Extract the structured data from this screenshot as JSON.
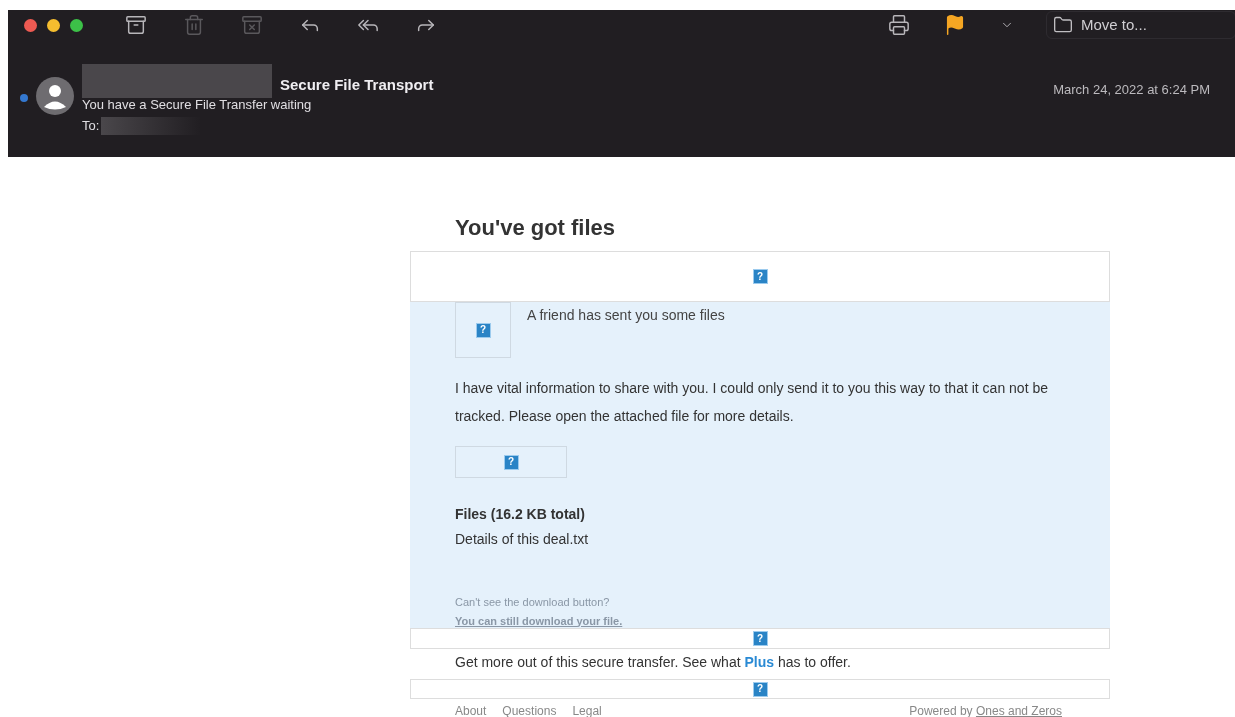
{
  "toolbar": {
    "left": [
      {
        "kind": "archive",
        "disabled": false
      },
      {
        "kind": "trash",
        "disabled": true
      },
      {
        "kind": "junk",
        "disabled": true
      },
      {
        "kind": "reply",
        "disabled": false
      },
      {
        "kind": "reply-all",
        "disabled": false
      },
      {
        "kind": "forward",
        "disabled": false
      }
    ],
    "right": [
      {
        "kind": "print",
        "disabled": false
      },
      {
        "kind": "flag",
        "color": "#f5a623"
      },
      {
        "kind": "chevron",
        "disabled": false
      }
    ],
    "move_button": {
      "label": "Move to..."
    }
  },
  "message": {
    "unread": true,
    "sender_visible": "Secure File Transport",
    "subject": "You have a Secure File Transfer waiting",
    "to_label": "To:",
    "date": "March 24, 2022 at 6:24 PM"
  },
  "email": {
    "heading": "You've got files",
    "banner_image": {
      "glyph": "?"
    },
    "logo_image": {
      "glyph": "?"
    },
    "intro": "A friend has sent you some files",
    "body": "I have vital information to share with you. I could only send it to you this way to that it can not be tracked. Please open the attached file for more details.",
    "button_image": {
      "glyph": "?"
    },
    "files_title": "Files (16.2 KB total)",
    "files": [
      "Details of this deal.txt"
    ],
    "help_text": "Can't see the download button?",
    "help_link": "You can still download your file.",
    "divider_image": {
      "glyph": "?"
    },
    "promo": {
      "before": "Get more out of this secure transfer. See what ",
      "link": "Plus",
      "after": " has to offer."
    },
    "footer_image": {
      "glyph": "?"
    },
    "footer_links": [
      "About",
      "Questions",
      "Legal"
    ],
    "powered_by": {
      "text": "Powered by",
      "link": "Ones and Zeros"
    }
  }
}
